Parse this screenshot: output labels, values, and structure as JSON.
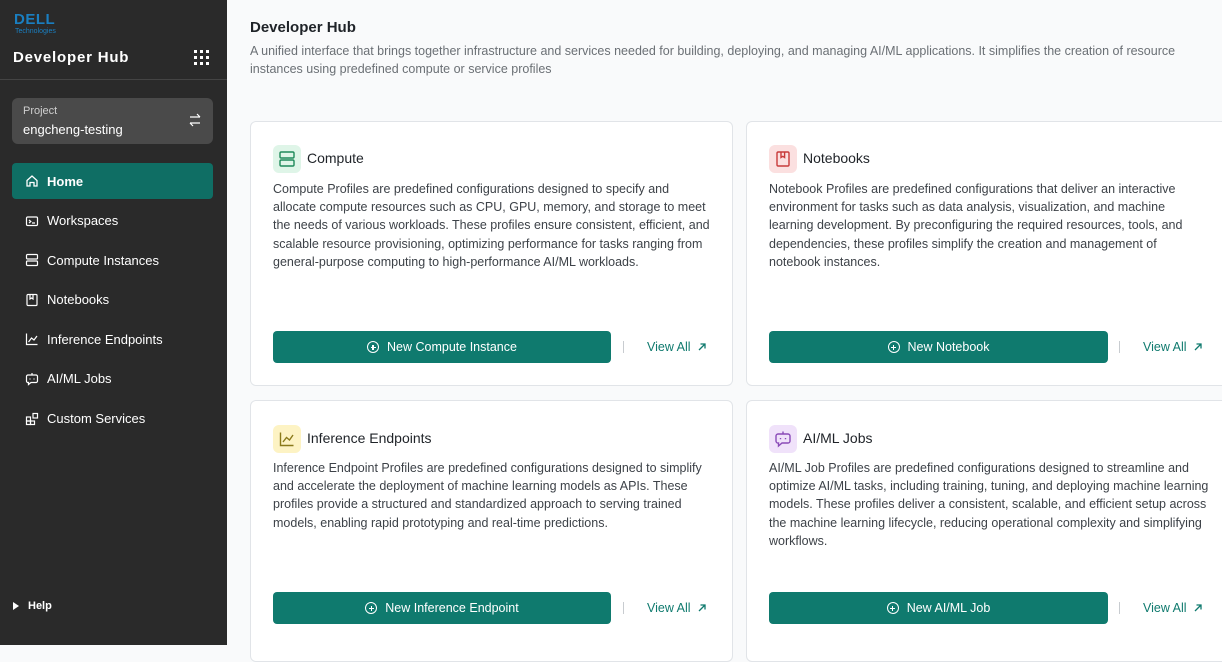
{
  "brand": {
    "logo_word": "DELL",
    "logo_sub": "Technologies"
  },
  "sidebar": {
    "app_title": "Developer Hub",
    "project": {
      "label": "Project",
      "name": "engcheng-testing"
    },
    "items": [
      {
        "label": "Home",
        "icon": "home-icon",
        "active": true
      },
      {
        "label": "Workspaces",
        "icon": "workspaces-icon"
      },
      {
        "label": "Compute Instances",
        "icon": "server-icon"
      },
      {
        "label": "Notebooks",
        "icon": "notebook-icon"
      },
      {
        "label": "Inference Endpoints",
        "icon": "chart-line-icon"
      },
      {
        "label": "AI/ML Jobs",
        "icon": "bot-icon"
      },
      {
        "label": "Custom Services",
        "icon": "blocks-icon"
      }
    ],
    "help": "Help"
  },
  "main": {
    "title": "Developer Hub",
    "description": "A unified interface that brings together infrastructure and services needed for building, deploying, and managing AI/ML applications. It simplifies the creation of resource instances using predefined compute or service profiles",
    "cards": [
      {
        "title": "Compute",
        "icon": "server-icon",
        "description": "Compute Profiles are predefined configurations designed to specify and allocate compute resources such as CPU, GPU, memory, and storage to meet the needs of various workloads. These profiles ensure consistent, efficient, and scalable resource provisioning, optimizing performance for tasks ranging from general-purpose computing to high-performance AI/ML workloads.",
        "button": "New Compute Instance",
        "view_all": "View All"
      },
      {
        "title": "Notebooks",
        "icon": "notebook-icon",
        "description": "Notebook Profiles are predefined configurations that deliver an interactive environment for tasks such as data analysis, visualization, and machine learning development. By preconfiguring the required resources, tools, and dependencies, these profiles simplify the creation and management of notebook instances.",
        "button": "New Notebook",
        "view_all": "View All"
      },
      {
        "title": "Inference Endpoints",
        "icon": "chart-line-icon",
        "description": "Inference Endpoint Profiles are predefined configurations designed to simplify and accelerate the deployment of machine learning models as APIs. These profiles provide a structured and standardized approach to serving trained models, enabling rapid prototyping and real-time predictions.",
        "button": "New Inference Endpoint",
        "view_all": "View All"
      },
      {
        "title": "AI/ML Jobs",
        "icon": "bot-icon",
        "description": "AI/ML Job Profiles are predefined configurations designed to streamline and optimize AI/ML tasks, including training, tuning, and deploying machine learning models. These profiles deliver a consistent, scalable, and efficient setup across the machine learning lifecycle, reducing operational complexity and simplifying workflows.",
        "button": "New AI/ML Job",
        "view_all": "View All"
      }
    ]
  },
  "colors": {
    "sidebar_bg": "#2a2a2a",
    "accent": "#0f7a6e",
    "active_nav": "#0f6e64",
    "brand_blue": "#1a7fc1"
  }
}
